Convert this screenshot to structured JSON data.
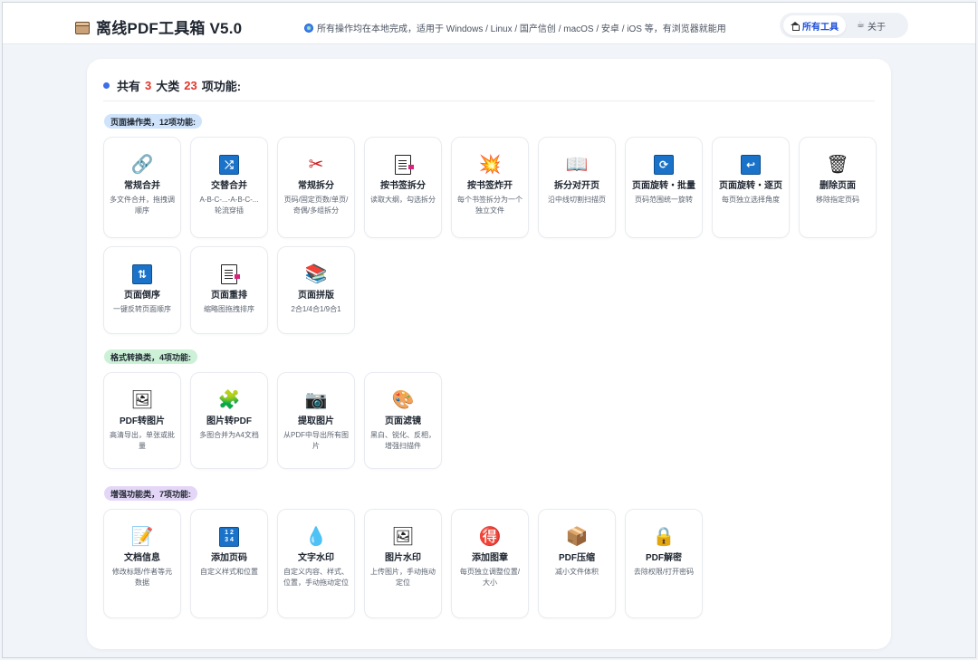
{
  "header": {
    "title": "离线PDF工具箱 V5.0",
    "notice": "所有操作均在本地完成，适用于 Windows / Linux / 国产信创 / macOS / 安卓 / iOS 等，有浏览器就能用",
    "nav": [
      {
        "label": "所有工具",
        "icon": "home-icon",
        "active": true
      },
      {
        "label": "关于",
        "icon": "coffee-icon",
        "active": false
      }
    ]
  },
  "summary": {
    "prefix": "共有",
    "categories_count": "3",
    "middle": "大类",
    "functions_count": "23",
    "suffix": "项功能:"
  },
  "categories": [
    {
      "label": "页面操作类，12项功能:",
      "tools": [
        {
          "title": "常规合并",
          "desc": "多文件合并，拖拽调顺序",
          "icon": "paperclip-icon"
        },
        {
          "title": "交替合并",
          "desc": "A-B-C-...-A-B-C-... 轮流穿插",
          "icon": "shuffle-icon"
        },
        {
          "title": "常规拆分",
          "desc": "页码/固定页数/单页/奇偶/多组拆分",
          "icon": "scissors-icon"
        },
        {
          "title": "按书签拆分",
          "desc": "读取大纲，勾选拆分",
          "icon": "bookmark-doc-icon"
        },
        {
          "title": "按书签炸开",
          "desc": "每个书签拆分为一个独立文件",
          "icon": "explosion-icon"
        },
        {
          "title": "拆分对开页",
          "desc": "沿中线切割扫描页",
          "icon": "open-book-icon"
        },
        {
          "title": "页面旋转・批量",
          "desc": "页码范围统一旋转",
          "icon": "rotate-icon"
        },
        {
          "title": "页面旋转・逐页",
          "desc": "每页独立选择角度",
          "icon": "return-arrow-icon"
        },
        {
          "title": "删除页面",
          "desc": "移除指定页码",
          "icon": "trash-icon"
        },
        {
          "title": "页面倒序",
          "desc": "一键反转页面顺序",
          "icon": "reverse-icon"
        },
        {
          "title": "页面重排",
          "desc": "缩略图拖拽排序",
          "icon": "bookmark-doc-icon"
        },
        {
          "title": "页面拼版",
          "desc": "2合1/4合1/9合1",
          "icon": "books-icon"
        }
      ]
    },
    {
      "label": "格式转换类，4项功能:",
      "tools": [
        {
          "title": "PDF转图片",
          "desc": "高清导出，单张或批量",
          "icon": "framed-picture-icon"
        },
        {
          "title": "图片转PDF",
          "desc": "多图合并为A4文档",
          "icon": "puzzle-icon"
        },
        {
          "title": "提取图片",
          "desc": "从PDF中导出所有图片",
          "icon": "camera-icon"
        },
        {
          "title": "页面滤镜",
          "desc": "黑白、锐化、反相，增强扫描件",
          "icon": "palette-icon"
        }
      ]
    },
    {
      "label": "增强功能类，7项功能:",
      "tools": [
        {
          "title": "文档信息",
          "desc": "修改标题/作者等元数据",
          "icon": "memo-icon"
        },
        {
          "title": "添加页码",
          "desc": "自定义样式和位置",
          "icon": "numbers-icon"
        },
        {
          "title": "文字水印",
          "desc": "自定义内容、样式、位置，手动拖动定位",
          "icon": "droplet-icon"
        },
        {
          "title": "图片水印",
          "desc": "上传图片，手动拖动定位",
          "icon": "framed-picture-icon"
        },
        {
          "title": "添加图章",
          "desc": "每页独立调整位置/大小",
          "icon": "stamp-icon"
        },
        {
          "title": "PDF压缩",
          "desc": "减小文件体积",
          "icon": "package-icon"
        },
        {
          "title": "PDF解密",
          "desc": "去除权限/打开密码",
          "icon": "lock-icon"
        }
      ]
    }
  ]
}
